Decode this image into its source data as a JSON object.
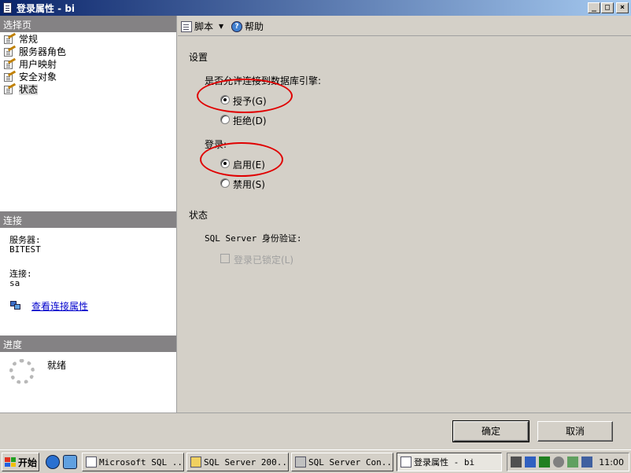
{
  "window": {
    "title": "登录属性 - bi",
    "minimize": "_",
    "maximize": "□",
    "close": "×"
  },
  "left_pane": {
    "select_page_header": "选择页",
    "pages": [
      {
        "label": "常规"
      },
      {
        "label": "服务器角色"
      },
      {
        "label": "用户映射"
      },
      {
        "label": "安全对象"
      },
      {
        "label": "状态"
      }
    ],
    "connection_header": "连接",
    "server_label": "服务器:",
    "server_value": "BITEST",
    "connection_label": "连接:",
    "connection_value": "sa",
    "view_connection_link": "查看连接属性",
    "progress_header": "进度",
    "progress_status": "就绪"
  },
  "toolbar": {
    "script_label": "脚本",
    "help_label": "帮助"
  },
  "settings": {
    "section_title": "设置",
    "permission_question": "是否允许连接到数据库引擎:",
    "grant_label": "授予(G)",
    "deny_label": "拒绝(D)",
    "login_label": "登录:",
    "enable_label": "启用(E)",
    "disable_label": "禁用(S)",
    "grant_selected": true,
    "enable_selected": true
  },
  "status": {
    "section_title": "状态",
    "auth_label": "SQL Server 身份验证:",
    "locked_label": "登录已锁定(L)"
  },
  "buttons": {
    "ok": "确定",
    "cancel": "取消"
  },
  "taskbar": {
    "start": "开始",
    "tasks": [
      {
        "label": "Microsoft SQL ..."
      },
      {
        "label": "SQL Server 200..."
      },
      {
        "label": "SQL Server Con..."
      },
      {
        "label": "登录属性 - bi"
      }
    ],
    "clock": "11:00"
  },
  "colors": {
    "annotation_ellipse": "#e00000",
    "titlebar_start": "#0a246a",
    "link": "#0000cc"
  }
}
